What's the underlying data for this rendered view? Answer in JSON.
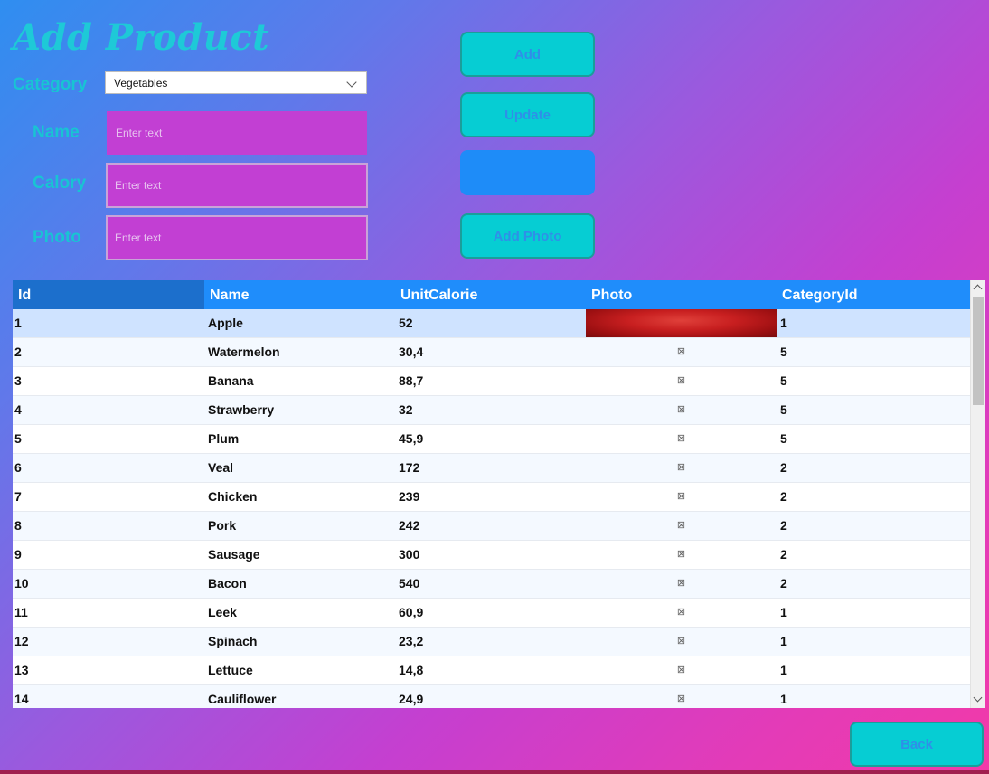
{
  "title": "Add Product",
  "form": {
    "category_label": "Category",
    "category_value": "Vegetables",
    "name_label": "Name",
    "calory_label": "Calory",
    "photo_label": "Photo",
    "name_placeholder": "Enter text",
    "calory_placeholder": "Enter text",
    "photo_placeholder": "Enter text"
  },
  "buttons": {
    "add": "Add",
    "update": "Update",
    "blank": "",
    "add_photo": "Add Photo",
    "back": "Back"
  },
  "grid": {
    "columns": [
      "Id",
      "Name",
      "UnitCalorie",
      "Photo",
      "CategoryId"
    ],
    "photo_placeholder_glyph": "⊠",
    "rows": [
      {
        "id": "1",
        "name": "Apple",
        "cal": "52",
        "has_photo": true,
        "cat": "1"
      },
      {
        "id": "2",
        "name": "Watermelon",
        "cal": "30,4",
        "has_photo": false,
        "cat": "5"
      },
      {
        "id": "3",
        "name": "Banana",
        "cal": "88,7",
        "has_photo": false,
        "cat": "5"
      },
      {
        "id": "4",
        "name": "Strawberry",
        "cal": "32",
        "has_photo": false,
        "cat": "5"
      },
      {
        "id": "5",
        "name": "Plum",
        "cal": "45,9",
        "has_photo": false,
        "cat": "5"
      },
      {
        "id": "6",
        "name": "Veal",
        "cal": "172",
        "has_photo": false,
        "cat": "2"
      },
      {
        "id": "7",
        "name": "Chicken",
        "cal": "239",
        "has_photo": false,
        "cat": "2"
      },
      {
        "id": "8",
        "name": "Pork",
        "cal": "242",
        "has_photo": false,
        "cat": "2"
      },
      {
        "id": "9",
        "name": "Sausage",
        "cal": "300",
        "has_photo": false,
        "cat": "2"
      },
      {
        "id": "10",
        "name": "Bacon",
        "cal": "540",
        "has_photo": false,
        "cat": "2"
      },
      {
        "id": "11",
        "name": "Leek",
        "cal": "60,9",
        "has_photo": false,
        "cat": "1"
      },
      {
        "id": "12",
        "name": "Spinach",
        "cal": "23,2",
        "has_photo": false,
        "cat": "1"
      },
      {
        "id": "13",
        "name": "Lettuce",
        "cal": "14,8",
        "has_photo": false,
        "cat": "1"
      },
      {
        "id": "14",
        "name": "Cauliflower",
        "cal": "24,9",
        "has_photo": false,
        "cat": "1"
      }
    ]
  },
  "colors": {
    "accent_cyan": "#06cdd3",
    "header_blue": "#1f8dfb",
    "textbox_magenta": "#c23fd3"
  }
}
